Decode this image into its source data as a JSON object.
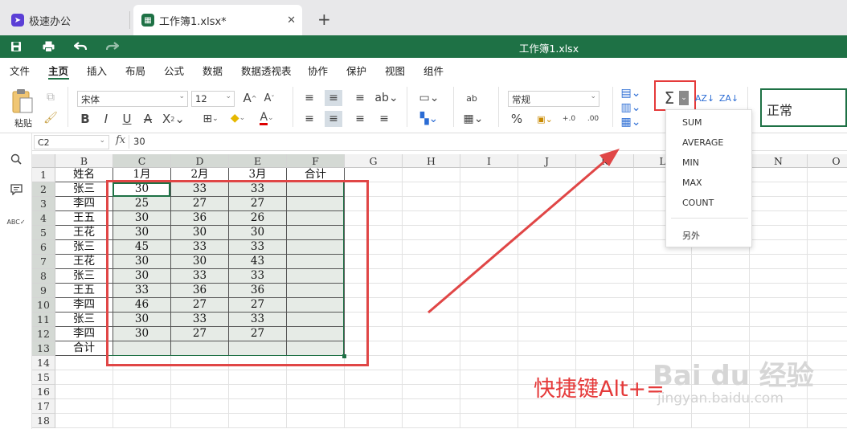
{
  "tabs": [
    {
      "label": "极速办公",
      "icon": "rocket-icon",
      "color": "#5b3fd6"
    },
    {
      "label": "工作簿1.xlsx*",
      "icon": "spreadsheet-icon",
      "color": "#1e7145",
      "close": "✕"
    }
  ],
  "new_tab": "+",
  "titlebar": {
    "title": "工作簿1.xlsx"
  },
  "menu": [
    "文件",
    "主页",
    "插入",
    "布局",
    "公式",
    "数据",
    "数据透视表",
    "协作",
    "保护",
    "视图",
    "组件"
  ],
  "ribbon": {
    "paste_label": "粘贴",
    "font_name": "宋体",
    "font_size": "12",
    "number_format": "常规",
    "style_preview": "正常",
    "sigma": "Σ"
  },
  "formula_bar": {
    "cell_ref": "C2",
    "fx": "fx",
    "value": "30"
  },
  "columns": [
    "B",
    "C",
    "D",
    "E",
    "F",
    "G",
    "H",
    "I",
    "J",
    "K",
    "L",
    "M",
    "N",
    "O"
  ],
  "rows": [
    "1",
    "2",
    "3",
    "4",
    "5",
    "6",
    "7",
    "8",
    "9",
    "10",
    "11",
    "12",
    "13",
    "14",
    "15",
    "16",
    "17",
    "18"
  ],
  "table": {
    "header": [
      "姓名",
      "1月",
      "2月",
      "3月",
      "合计"
    ],
    "body": [
      [
        "张三",
        "30",
        "33",
        "33",
        ""
      ],
      [
        "李四",
        "25",
        "27",
        "27",
        ""
      ],
      [
        "王五",
        "30",
        "36",
        "26",
        ""
      ],
      [
        "王花",
        "30",
        "30",
        "30",
        ""
      ],
      [
        "张三",
        "45",
        "33",
        "33",
        ""
      ],
      [
        "王花",
        "30",
        "30",
        "43",
        ""
      ],
      [
        "张三",
        "30",
        "33",
        "33",
        ""
      ],
      [
        "王五",
        "33",
        "36",
        "36",
        ""
      ],
      [
        "李四",
        "46",
        "27",
        "27",
        ""
      ],
      [
        "张三",
        "30",
        "33",
        "33",
        ""
      ],
      [
        "李四",
        "30",
        "27",
        "27",
        ""
      ],
      [
        "合计",
        "",
        "",
        "",
        ""
      ]
    ]
  },
  "dropdown": {
    "items": [
      "SUM",
      "AVERAGE",
      "MIN",
      "MAX",
      "COUNT"
    ],
    "other": "另外"
  },
  "annotation": {
    "text": "快捷键Alt+=",
    "color": "#e53a3a"
  },
  "watermark": {
    "brand": "Bai du 经验",
    "url": "jingyan.baidu.com"
  }
}
